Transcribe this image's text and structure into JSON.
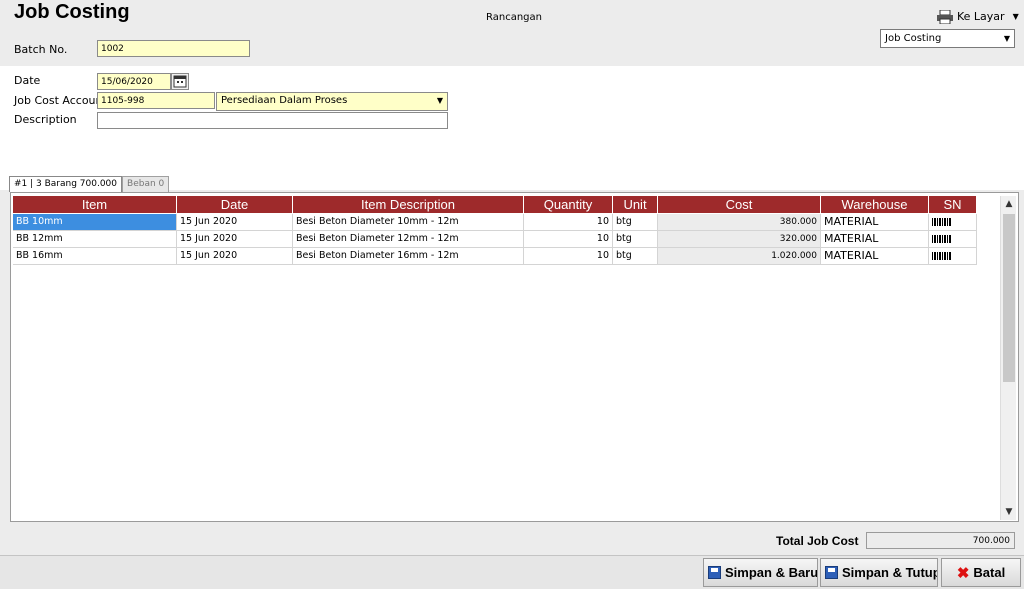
{
  "header": {
    "title": "Job Costing",
    "status": "Rancangan",
    "print_label": "Ke Layar",
    "form_select": "Job Costing"
  },
  "form": {
    "batch_label": "Batch No.",
    "batch_value": "1002",
    "date_label": "Date",
    "date_value": "15/06/2020",
    "account_label": "Job Cost Account",
    "account_code": "1105-998",
    "account_name": "Persediaan Dalam Proses",
    "description_label": "Description",
    "description_value": ""
  },
  "tabs": [
    {
      "label": "#1 | 3  Barang  700.000"
    },
    {
      "label": "Beban  0"
    }
  ],
  "grid": {
    "columns": [
      "Item",
      "Date",
      "Item Description",
      "Quantity",
      "Unit",
      "Cost",
      "Warehouse",
      "SN"
    ],
    "rows": [
      {
        "item": "BB 10mm",
        "date": "15 Jun 2020",
        "description": "Besi Beton Diameter 10mm - 12m",
        "quantity": "10",
        "unit": "btg",
        "cost": "380.000",
        "warehouse": "MATERIAL"
      },
      {
        "item": "BB 12mm",
        "date": "15 Jun 2020",
        "description": "Besi Beton Diameter 12mm - 12m",
        "quantity": "10",
        "unit": "btg",
        "cost": "320.000",
        "warehouse": "MATERIAL"
      },
      {
        "item": "BB 16mm",
        "date": "15 Jun 2020",
        "description": "Besi Beton Diameter 16mm - 12m",
        "quantity": "10",
        "unit": "btg",
        "cost": "1.020.000",
        "warehouse": "MATERIAL"
      }
    ]
  },
  "footer": {
    "total_label": "Total Job Cost",
    "total_value": "700.000",
    "save_new": "Simpan & Baru",
    "save_close": "Simpan & Tutup",
    "cancel": "Batal"
  },
  "icons": {
    "printer": "printer-icon",
    "calendar": "calendar-icon",
    "save": "save-icon",
    "cancel": "cancel-icon",
    "dropdown": "chevron-down-icon",
    "barcode": "barcode-icon"
  },
  "colors": {
    "header_bg": "#9e2a2b",
    "field_bg": "#ffffc8",
    "selection": "#3d8ee0"
  }
}
